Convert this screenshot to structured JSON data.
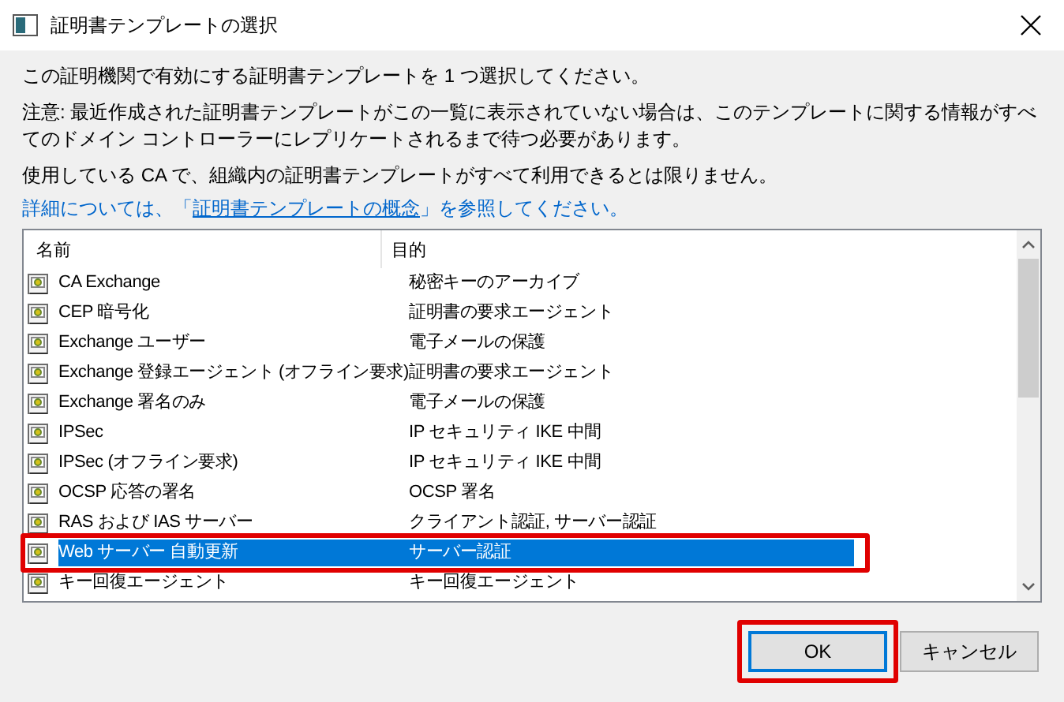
{
  "window": {
    "title": "証明書テンプレートの選択"
  },
  "intro": "この証明機関で有効にする証明書テンプレートを 1 つ選択してください。",
  "note": "注意: 最近作成された証明書テンプレートがこの一覧に表示されていない場合は、このテンプレートに関する情報がすべてのドメイン コントローラーにレプリケートされるまで待つ必要があります。",
  "availability": "使用している CA で、組織内の証明書テンプレートがすべて利用できるとは限りません。",
  "more_info": {
    "before": "詳細については、「",
    "link": "証明書テンプレートの概念",
    "after": "」を参照してください。"
  },
  "table": {
    "columns": [
      "名前",
      "目的"
    ],
    "rows": [
      {
        "name": "CA Exchange",
        "purpose": "秘密キーのアーカイブ",
        "selected": false,
        "highlighted": false
      },
      {
        "name": "CEP 暗号化",
        "purpose": "証明書の要求エージェント",
        "selected": false,
        "highlighted": false
      },
      {
        "name": "Exchange ユーザー",
        "purpose": "電子メールの保護",
        "selected": false,
        "highlighted": false
      },
      {
        "name": "Exchange 登録エージェント (オフライン要求)",
        "purpose": "証明書の要求エージェント",
        "selected": false,
        "highlighted": false
      },
      {
        "name": "Exchange 署名のみ",
        "purpose": "電子メールの保護",
        "selected": false,
        "highlighted": false
      },
      {
        "name": "IPSec",
        "purpose": "IP セキュリティ IKE 中間",
        "selected": false,
        "highlighted": false
      },
      {
        "name": "IPSec (オフライン要求)",
        "purpose": "IP セキュリティ IKE 中間",
        "selected": false,
        "highlighted": false
      },
      {
        "name": "OCSP 応答の署名",
        "purpose": "OCSP 署名",
        "selected": false,
        "highlighted": false
      },
      {
        "name": "RAS および IAS サーバー",
        "purpose": "クライアント認証, サーバー認証",
        "selected": false,
        "highlighted": false
      },
      {
        "name": "Web サーバー 自動更新",
        "purpose": "サーバー認証",
        "selected": true,
        "highlighted": true
      },
      {
        "name": "キー回復エージェント",
        "purpose": "キー回復エージェント",
        "selected": false,
        "highlighted": false
      }
    ]
  },
  "buttons": [
    {
      "label": "OK",
      "default": true,
      "highlighted": true
    },
    {
      "label": "キャンセル",
      "default": false,
      "highlighted": false
    }
  ]
}
